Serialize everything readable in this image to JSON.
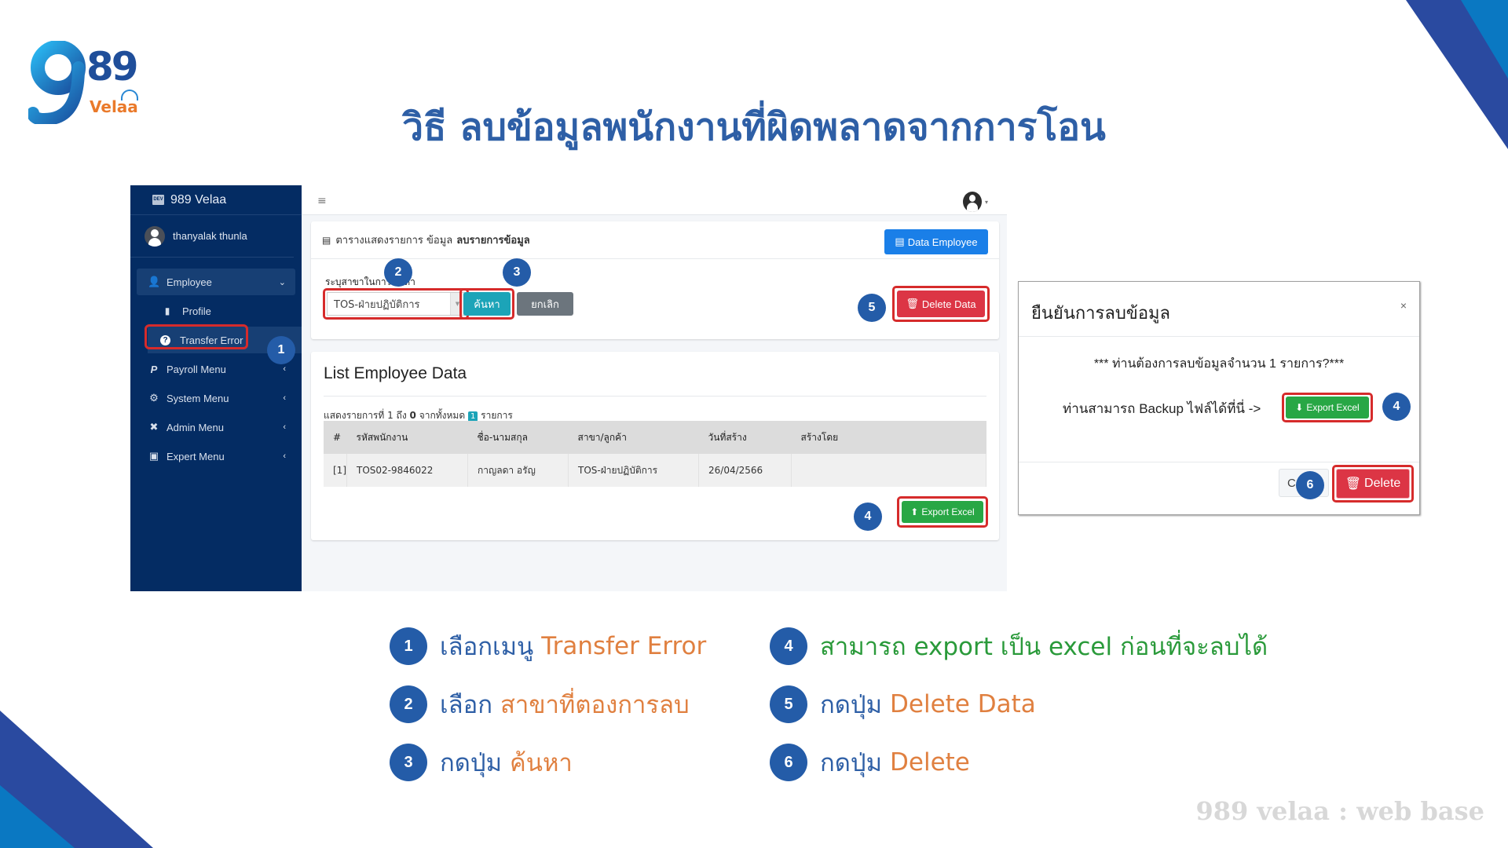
{
  "slide": {
    "title": "วิธี ลบข้อมูลพนักงานที่ผิดพลาดจากการโอน",
    "logo": {
      "mark": "9",
      "number": "89",
      "brand": "Velaa"
    },
    "watermark": "989 velaa : web base",
    "colors": {
      "title_blue": "#2e5fa6",
      "accent_orange": "#e08040",
      "accent_green": "#2a9a3a",
      "step_circle": "#245ca8",
      "highlight_red": "#d62b2b",
      "corner_dark": "#2a4aa0",
      "corner_light": "#0a78c2"
    }
  },
  "app": {
    "sidebar": {
      "brand_badge": "DEV",
      "brand": "989 Velaa",
      "user": "thanyalak thunla",
      "items": [
        {
          "label": "Employee",
          "icon": "user-icon",
          "glyph": "👤",
          "state": "expanded"
        },
        {
          "label": "Payroll Menu",
          "icon": "paypal-icon",
          "glyph": "P",
          "state": "collapsed"
        },
        {
          "label": "System Menu",
          "icon": "cogs-icon",
          "glyph": "⚙",
          "state": "collapsed"
        },
        {
          "label": "Admin Menu",
          "icon": "tools-icon",
          "glyph": "✖",
          "state": "collapsed"
        },
        {
          "label": "Expert Menu",
          "icon": "toolbox-icon",
          "glyph": "▣",
          "state": "collapsed"
        }
      ],
      "sub_items": [
        {
          "label": "Profile",
          "icon": "id-badge-icon",
          "glyph": "▮"
        },
        {
          "label": "Transfer Error",
          "icon": "question-circle-icon",
          "glyph": "?",
          "active": true
        }
      ],
      "chevron_open": "⌄",
      "chevron_closed": "‹"
    },
    "topbar": {
      "menu_glyph": "≡",
      "caret": "▾"
    },
    "filter_card": {
      "heading_prefix": "ตารางแสดงรายการ ข้อมูล",
      "heading_bold": "ลบรายการข้อมูล",
      "data_employee_button": "Data Employee",
      "branch_label": "ระบุสาขาในการค้นหา",
      "branch_selected": "TOS-ฝ่ายปฏิบัติการ",
      "search_button": "ค้นหา",
      "cancel_button": "ยกเลิก",
      "delete_data_button": "Delete Data"
    },
    "list_card": {
      "title": "List Employee Data",
      "showing_prefix": "แสดงรายการที่ 1 ถึง",
      "showing_to": "0",
      "showing_mid": "จากทั้งหมด",
      "showing_total": "1",
      "showing_suffix": "รายการ",
      "columns": [
        "#",
        "รหัสพนักงาน",
        "ชื่อ-นามสกุล",
        "สาขา/ลูกค้า",
        "วันที่สร้าง",
        "สร้างโดย"
      ],
      "rows": [
        [
          "[1]",
          "TOS02-9846022",
          "กาญลดา อรัญ",
          "TOS-ฝ่ายปฏิบัติการ",
          "26/04/2566",
          ""
        ]
      ],
      "export_button": "Export Excel"
    }
  },
  "modal": {
    "title": "ยืนยันการลบข้อมูล",
    "close_glyph": "×",
    "message": "*** ท่านต้องการลบข้อมูลจำนวน 1 รายการ?***",
    "backup_text": "ท่านสามารถ Backup ไฟล์ได้ที่นี่ ->",
    "export_button": "Export Excel",
    "close_button": "C",
    "delete_button": "Delete"
  },
  "steps": {
    "markers": [
      "1",
      "2",
      "3",
      "4",
      "5",
      "6"
    ],
    "instructions": [
      {
        "num": "1",
        "text": "เลือกเมนู",
        "highlight": "Transfer Error"
      },
      {
        "num": "2",
        "text": "เลือก",
        "highlight": "สาขาที่ตองการลบ"
      },
      {
        "num": "3",
        "text": "กดปุ่ม",
        "highlight": "ค้นหา"
      },
      {
        "num": "4",
        "text": "สามารถ export เป็น excel ก่อนที่จะลบได้",
        "highlight": ""
      },
      {
        "num": "5",
        "text": "กดปุ่ม",
        "highlight": "Delete Data"
      },
      {
        "num": "6",
        "text": "กดปุ่ม",
        "highlight": "Delete"
      }
    ]
  }
}
